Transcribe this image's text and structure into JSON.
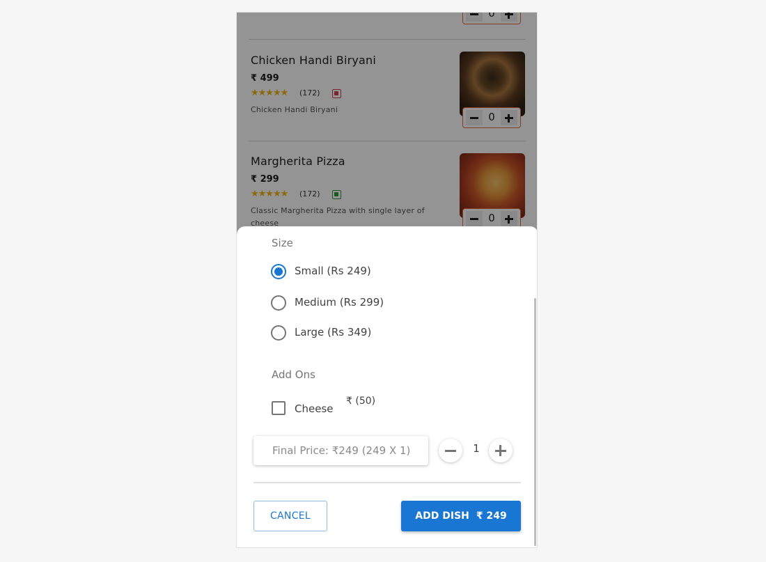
{
  "menu": {
    "items": [
      {
        "name": "Chicken Handi Biryani",
        "price": "₹ 499",
        "rating_count": "(172)",
        "stars": "★★★★★",
        "description": "Chicken Handi Biryani",
        "veg": false,
        "qty": "0"
      },
      {
        "name": "Margherita Pizza",
        "price": "₹ 299",
        "rating_count": "(172)",
        "stars": "★★★★★",
        "description": "Classic Margherita Pizza with single layer of cheese",
        "veg": true,
        "qty": "0"
      }
    ],
    "top_item_qty": "0"
  },
  "sheet": {
    "size_label": "Size",
    "sizes": [
      {
        "label": "Small (Rs 249)",
        "selected": true
      },
      {
        "label": "Medium (Rs 299)",
        "selected": false
      },
      {
        "label": "Large (Rs 349)",
        "selected": false
      }
    ],
    "addons_label": "Add Ons",
    "addons": [
      {
        "label": "Cheese",
        "price": "₹ (50)",
        "checked": false
      }
    ],
    "final_price": "Final Price: ₹249 (249 X 1)",
    "quantity": "1",
    "cancel_label": "CANCEL",
    "add_label": "ADD DISH",
    "add_price": "₹ 249"
  },
  "colors": {
    "accent": "#1976d2",
    "stepper_border": "#e2693f",
    "star": "#f1b30e",
    "veg": "#2e9b3a",
    "nonveg": "#d23f57"
  }
}
